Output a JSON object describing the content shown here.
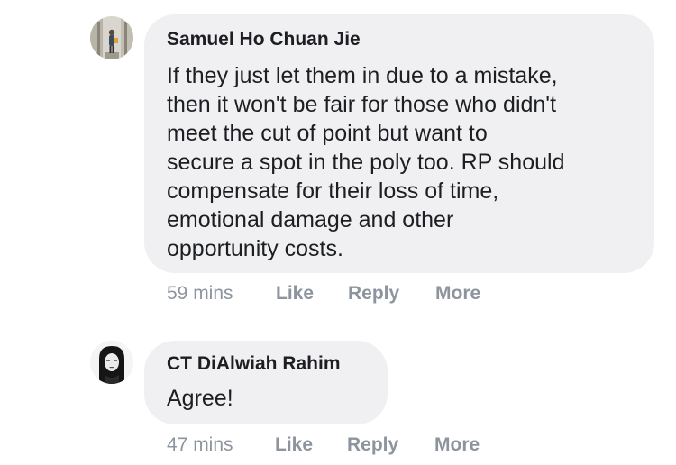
{
  "comments": [
    {
      "author": "Samuel Ho Chuan Jie",
      "body_lines": [
        "If they just let them in due to a mistake,",
        "then it won't be fair for those who didn't",
        "meet the cut of point but want to",
        "secure a spot in the poly too. RP should",
        "compensate for their loss of time,",
        "emotional damage and other",
        "opportunity costs."
      ],
      "time": "59 mins",
      "like_label": "Like",
      "reply_label": "Reply",
      "more_label": "More"
    },
    {
      "author": "CT DiAlwiah Rahim",
      "body_lines": [
        "Agree!"
      ],
      "time": "47 mins",
      "like_label": "Like",
      "reply_label": "Reply",
      "more_label": "More"
    }
  ],
  "colors": {
    "bubble": "#f0f0f2",
    "text": "#1c1e21",
    "meta": "#8d949e"
  }
}
